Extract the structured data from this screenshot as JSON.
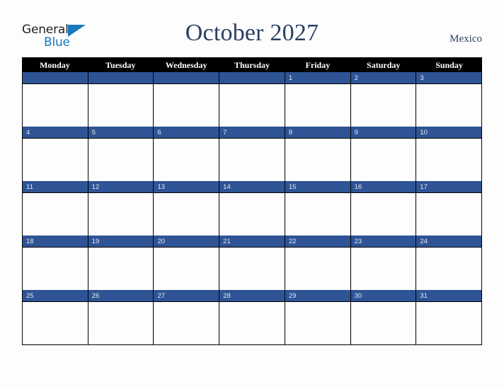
{
  "brand": {
    "name_part1": "General",
    "name_part2": "Blue",
    "triangle_icon": "blue-triangle-icon",
    "color_dark": "#231f20",
    "color_blue": "#1878be"
  },
  "header": {
    "title": "October 2027",
    "country": "Mexico",
    "title_color": "#2b3f63"
  },
  "calendar": {
    "month": "October",
    "year": "2027",
    "accent_color": "#2e5496",
    "header_bg": "#000000",
    "weekdays": [
      "Monday",
      "Tuesday",
      "Wednesday",
      "Thursday",
      "Friday",
      "Saturday",
      "Sunday"
    ],
    "weeks": [
      [
        {
          "date": ""
        },
        {
          "date": ""
        },
        {
          "date": ""
        },
        {
          "date": ""
        },
        {
          "date": "1"
        },
        {
          "date": "2"
        },
        {
          "date": "3"
        }
      ],
      [
        {
          "date": "4"
        },
        {
          "date": "5"
        },
        {
          "date": "6"
        },
        {
          "date": "7"
        },
        {
          "date": "8"
        },
        {
          "date": "9"
        },
        {
          "date": "10"
        }
      ],
      [
        {
          "date": "11"
        },
        {
          "date": "12"
        },
        {
          "date": "13"
        },
        {
          "date": "14"
        },
        {
          "date": "15"
        },
        {
          "date": "16"
        },
        {
          "date": "17"
        }
      ],
      [
        {
          "date": "18"
        },
        {
          "date": "19"
        },
        {
          "date": "20"
        },
        {
          "date": "21"
        },
        {
          "date": "22"
        },
        {
          "date": "23"
        },
        {
          "date": "24"
        }
      ],
      [
        {
          "date": "25"
        },
        {
          "date": "26"
        },
        {
          "date": "27"
        },
        {
          "date": "28"
        },
        {
          "date": "29"
        },
        {
          "date": "30"
        },
        {
          "date": "31"
        }
      ]
    ]
  }
}
